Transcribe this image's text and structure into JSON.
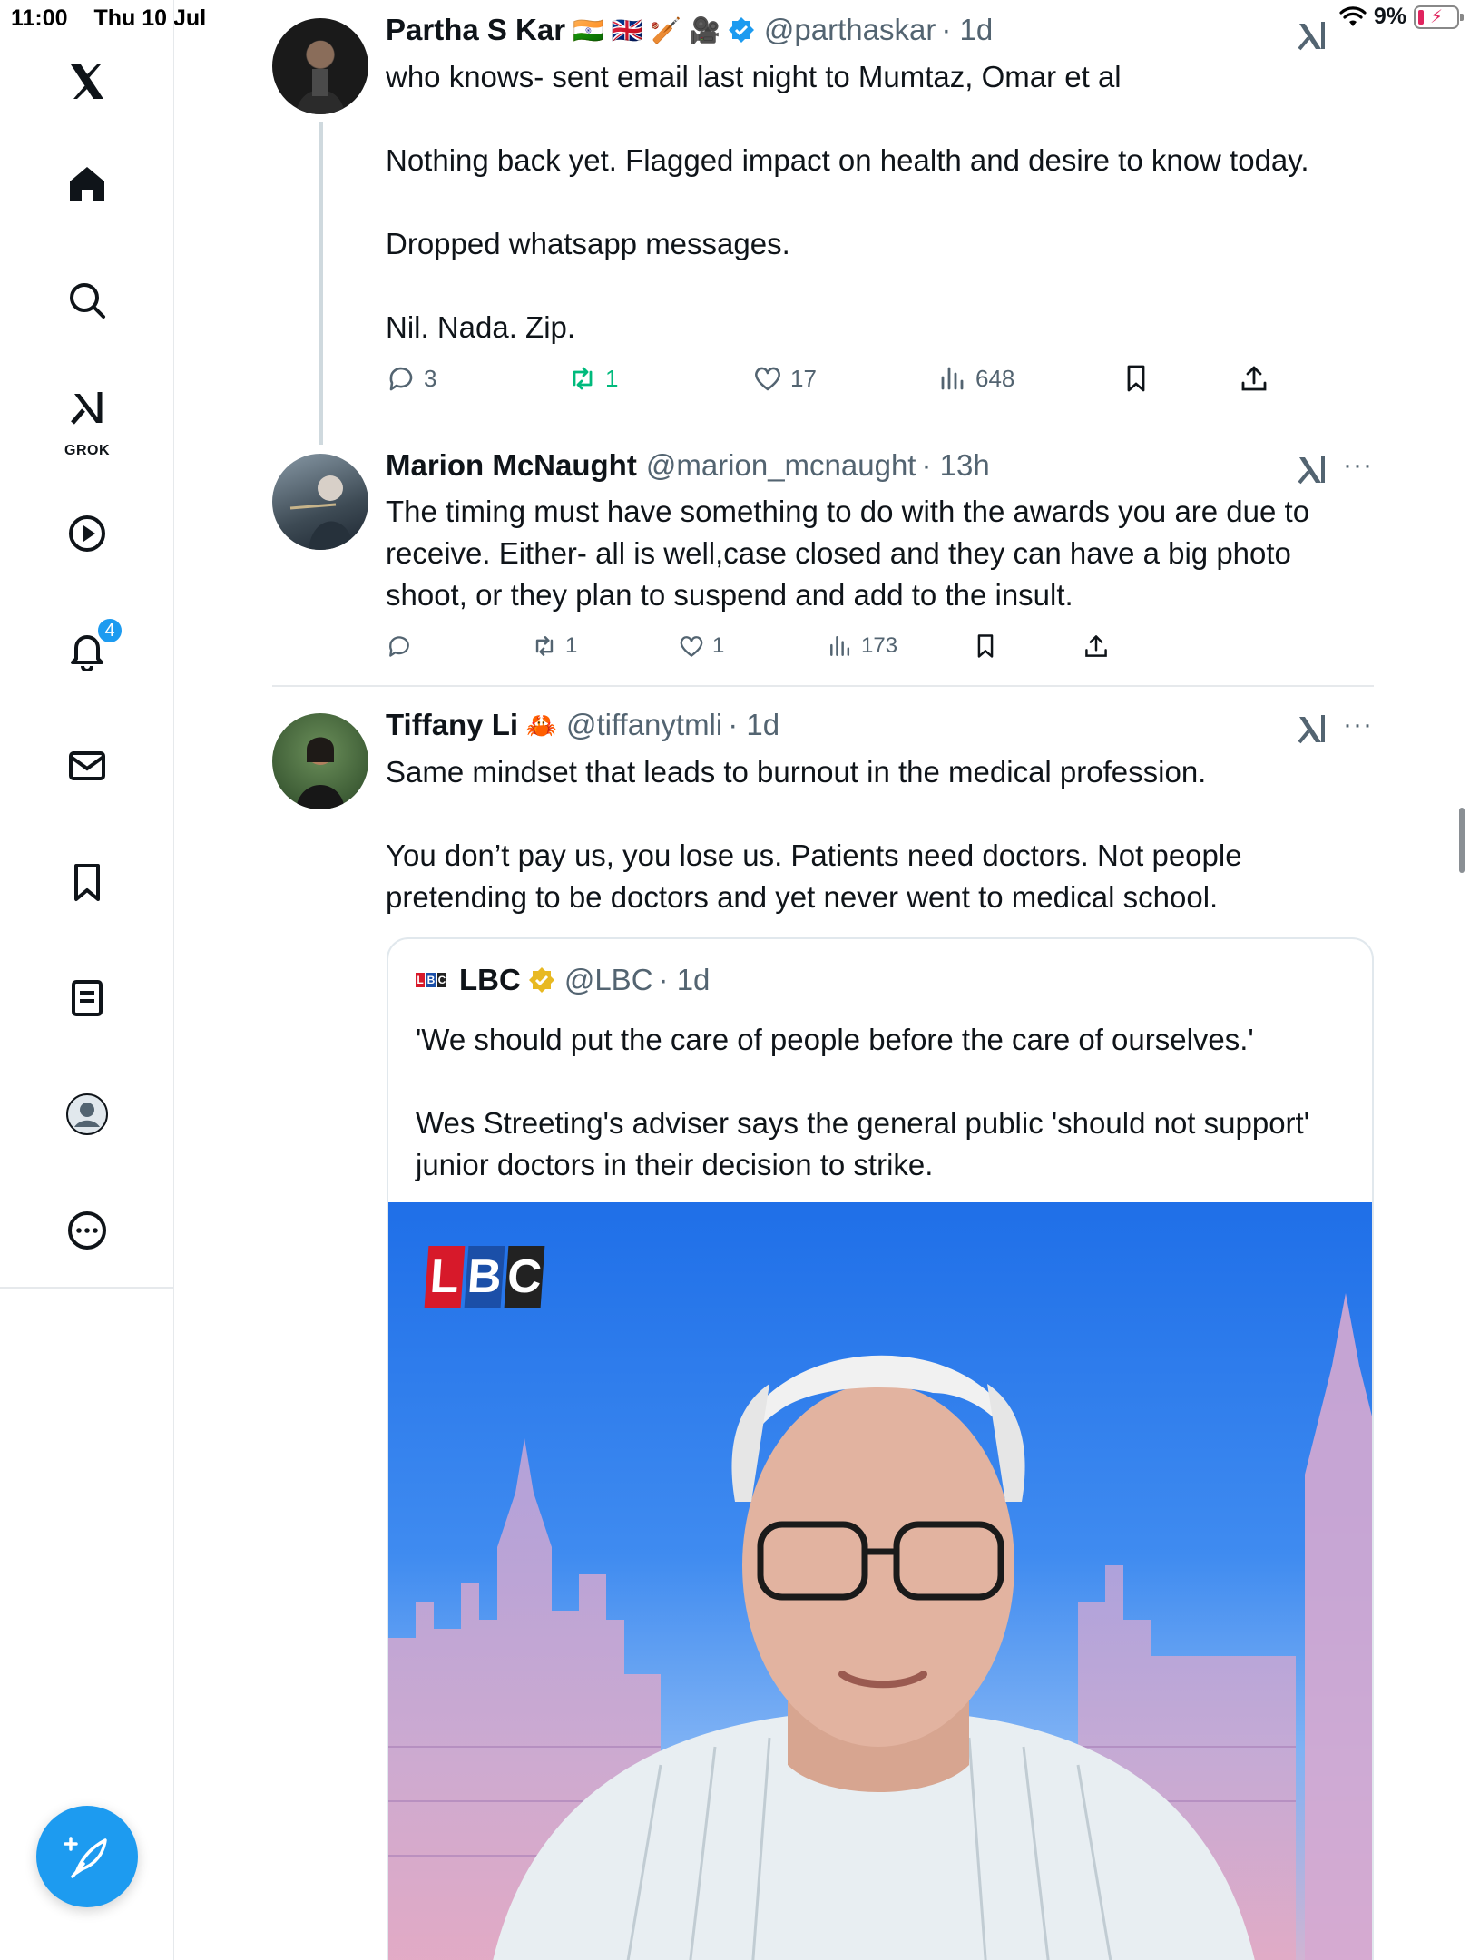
{
  "status_bar": {
    "time": "11:00",
    "date": "Thu 10 Jul",
    "battery": "9%"
  },
  "sidebar": {
    "items": [
      {
        "name": "x-logo",
        "label": "X"
      },
      {
        "name": "home",
        "label": "Home"
      },
      {
        "name": "search",
        "label": "Explore"
      },
      {
        "name": "grok",
        "label": "GROK"
      },
      {
        "name": "video",
        "label": "Video"
      },
      {
        "name": "notifications",
        "label": "Notifications",
        "badge": "4"
      },
      {
        "name": "messages",
        "label": "Messages"
      },
      {
        "name": "bookmarks",
        "label": "Bookmarks"
      },
      {
        "name": "lists",
        "label": "Lists"
      },
      {
        "name": "profile",
        "label": "Profile"
      },
      {
        "name": "more",
        "label": "More"
      }
    ],
    "grok_label": "GROK",
    "notifications_badge": "4"
  },
  "tweets": [
    {
      "name": "Partha S Kar",
      "emojis": "🇮🇳 🇬🇧 🏏 🎥",
      "handle": "@parthaskar",
      "time": "· 1d",
      "text": "who knows- sent email last night to Mumtaz, Omar et al\n\nNothing back yet. Flagged impact on health and desire to know today.\n\nDropped whatsapp messages.\n\nNil. Nada. Zip.",
      "replies": "3",
      "reposts": "1",
      "likes": "17",
      "views": "648"
    },
    {
      "name": "Marion McNaught",
      "handle": "@marion_mcnaught",
      "time": "· 13h",
      "text": "The timing must have something to do with the awards you are due to\nreceive. Either- all is well,case closed and they can have a big photo\nshoot, or they plan to suspend and add to the insult.",
      "replies": "",
      "reposts": "1",
      "likes": "1",
      "views": "173"
    },
    {
      "name": "Tiffany Li",
      "emojis": "🦀",
      "handle": "@tiffanytmli",
      "time": "· 1d",
      "text": "Same mindset that leads to burnout in the medical profession.\n\nYou don’t pay us, you lose us. Patients need doctors. Not people\npretending to be doctors and yet never went to medical school."
    }
  ],
  "quote": {
    "logo": "LBC",
    "name": "LBC",
    "handle": "@LBC",
    "time": "· 1d",
    "text": "'We should put the care of people before the care of ourselves.'\n\nWes Streeting's adviser says the general public 'should not support'\njunior doctors in their decision to strike.",
    "media_logo": [
      "L",
      "B",
      "C"
    ]
  },
  "colors": {
    "accent": "#1d9bf0",
    "repost_green": "#00ba7c",
    "muted": "#536471",
    "lbc_red": "#d7192a",
    "lbc_blue": "#1b4fa8",
    "lbc_dark": "#222222",
    "verified_gold": "#e8b923"
  }
}
